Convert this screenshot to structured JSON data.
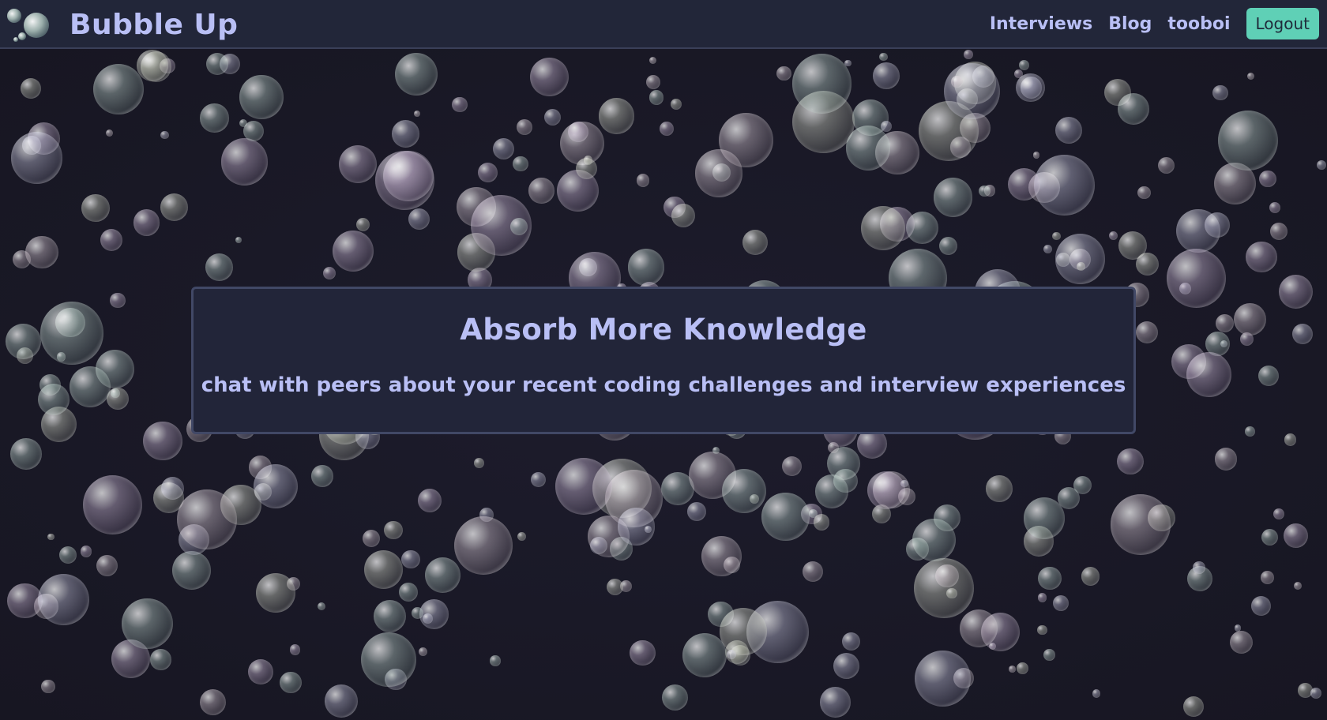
{
  "navbar": {
    "brand": "Bubble Up",
    "links": [
      "Interviews",
      "Blog",
      "tooboi"
    ],
    "logout_label": "Logout"
  },
  "hero": {
    "title": "Absorb More Knowledge",
    "subtitle": "chat with peers about your recent coding challenges and interview experiences"
  },
  "colors": {
    "navbar_bg": "#222639",
    "accent_text": "#b9bff5",
    "logout_bg": "#5fd0b6",
    "page_bg": "#1b1b2a",
    "card_bg": "#222539"
  },
  "icons": {
    "logo": "bubbles-logo-icon",
    "background": "bubbles-background"
  }
}
